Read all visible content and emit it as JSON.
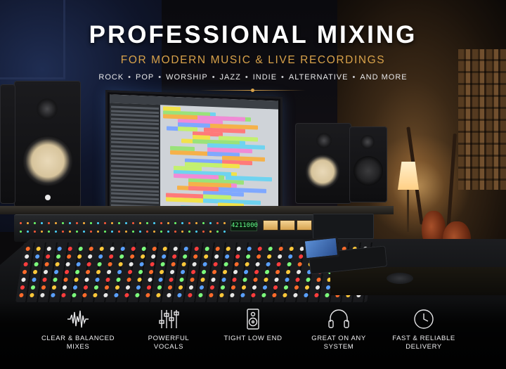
{
  "hero": {
    "title": "PROFESSIONAL MIXING",
    "subtitle": "FOR MODERN MUSIC & LIVE RECORDINGS",
    "genres": [
      "ROCK",
      "POP",
      "WORSHIP",
      "JAZZ",
      "INDIE",
      "ALTERNATIVE",
      "AND MORE"
    ],
    "genre_separator": "•"
  },
  "console": {
    "display_readout": "4211000"
  },
  "features": [
    {
      "label": "CLEAR & BALANCED\nMIXES",
      "icon": "waveform-icon"
    },
    {
      "label": "POWERFUL\nVOCALS",
      "icon": "sliders-icon"
    },
    {
      "label": "TIGHT LOW END",
      "icon": "speaker-icon"
    },
    {
      "label": "GREAT ON ANY\nSYSTEM",
      "icon": "headphones-icon"
    },
    {
      "label": "FAST & RELIABLE\nDELIVERY",
      "icon": "clock-icon"
    }
  ],
  "colors": {
    "title": "#ffffff",
    "subtitle_accent": "#d8a24a",
    "feature_text": "#f0f0f2"
  }
}
